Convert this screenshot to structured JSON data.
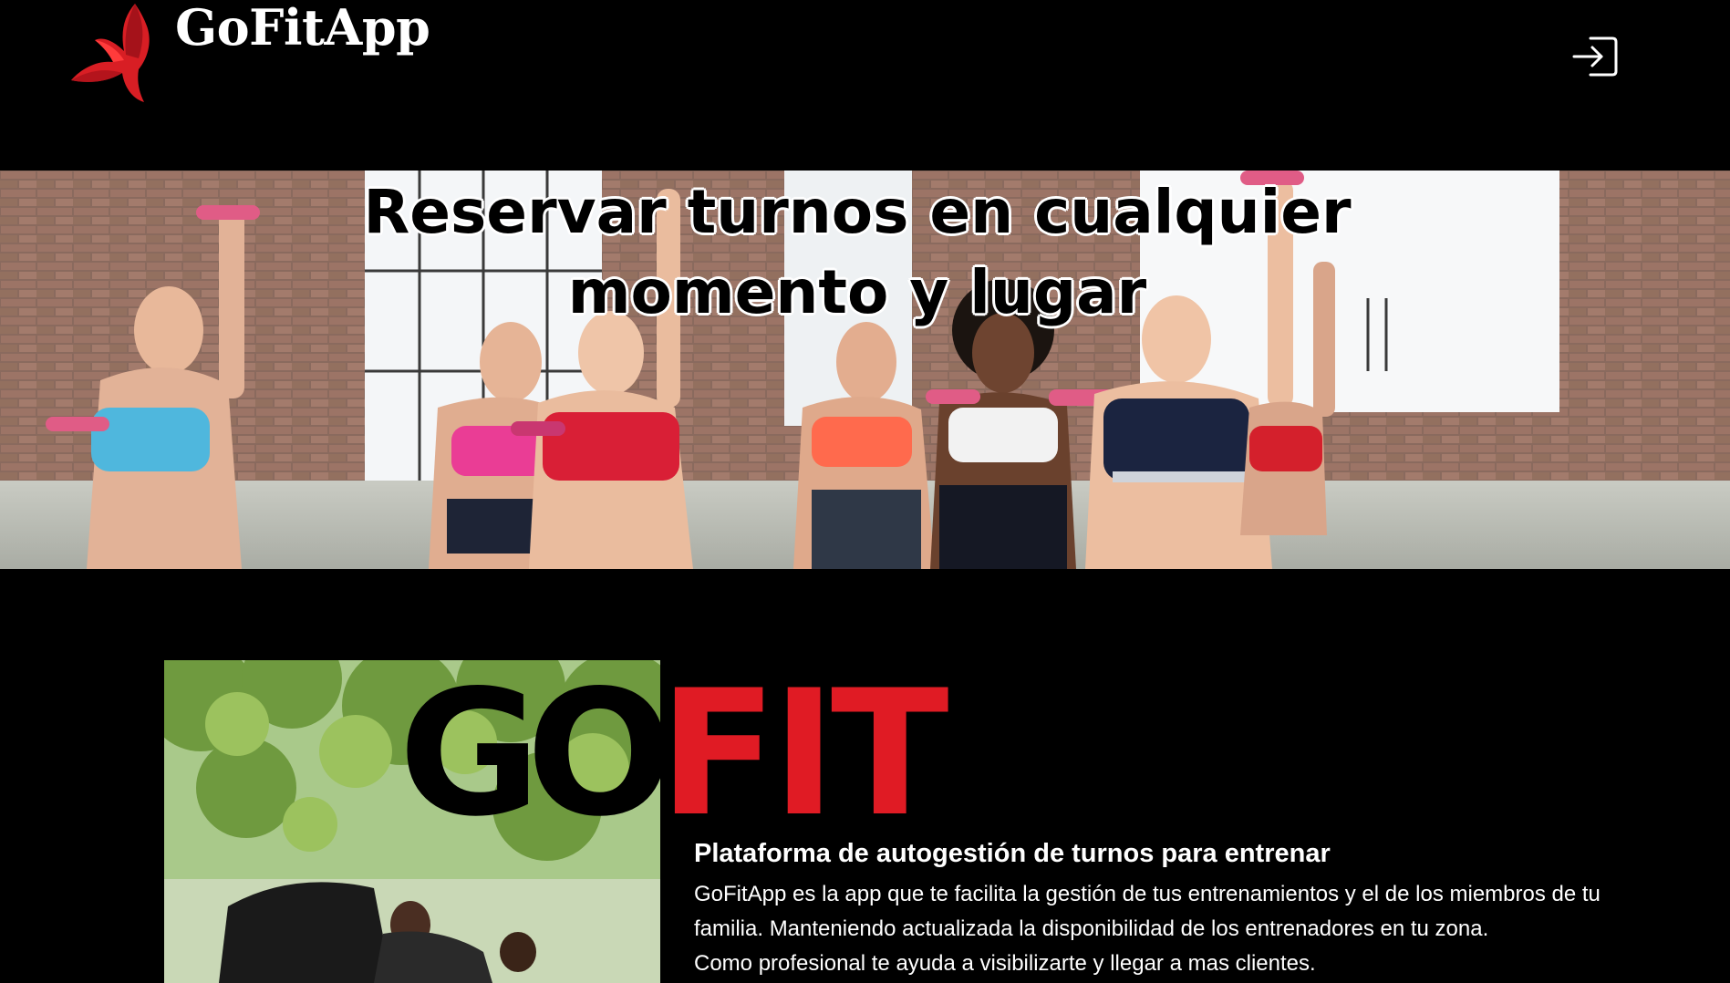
{
  "header": {
    "brand_name": "GoFitApp",
    "logo_icon": "butterfly-logo-icon",
    "login_icon": "login-icon"
  },
  "hero": {
    "title": "Reservar turnos en cualquier momento y lugar",
    "image": "group-fitness-class-photo"
  },
  "about": {
    "logo_go": "GO",
    "logo_fit": "FIT",
    "image": "outdoor-training-photo",
    "heading": "Plataforma de autogestión de turnos para entrenar",
    "paragraph_1": "GoFitApp es la app que te facilita la gestión de tus entrenamientos y el de los miembros de tu familia. Manteniendo actualizada la disponibilidad de los entrenadores en tu zona.",
    "paragraph_2": "Como profesional te ayuda a visibilizarte y llegar a mas clientes."
  },
  "colors": {
    "background": "#000000",
    "accent": "#e01b24",
    "text": "#ffffff"
  }
}
